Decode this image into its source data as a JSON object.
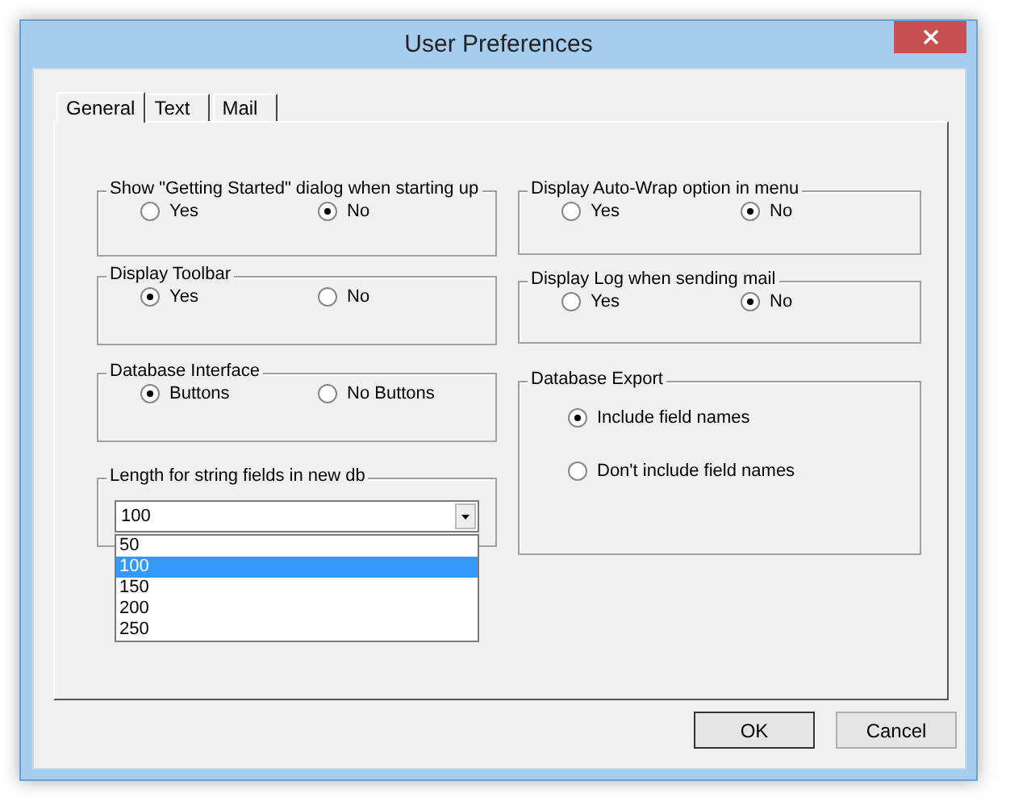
{
  "window": {
    "title": "User Preferences"
  },
  "tabs": [
    {
      "label": "General",
      "selected": true
    },
    {
      "label": "Text",
      "selected": false
    },
    {
      "label": "Mail",
      "selected": false
    }
  ],
  "left_groups": [
    {
      "kind": "radio",
      "title": "Show \"Getting Started\" dialog when starting up",
      "options": [
        {
          "label": "Yes",
          "selected": false
        },
        {
          "label": "No",
          "selected": true
        }
      ]
    },
    {
      "kind": "radio",
      "title": "Display Toolbar",
      "options": [
        {
          "label": "Yes",
          "selected": true
        },
        {
          "label": "No",
          "selected": false
        }
      ]
    },
    {
      "kind": "radio",
      "title": "Database Interface",
      "options": [
        {
          "label": "Buttons",
          "selected": true
        },
        {
          "label": "No Buttons",
          "selected": false
        }
      ]
    },
    {
      "kind": "combo",
      "title": "Length for string fields in new db",
      "value": "100",
      "expanded": true,
      "options": [
        {
          "label": "50",
          "selected": false
        },
        {
          "label": "100",
          "selected": true
        },
        {
          "label": "150",
          "selected": false
        },
        {
          "label": "200",
          "selected": false
        },
        {
          "label": "250",
          "selected": false
        }
      ]
    }
  ],
  "right_groups": [
    {
      "kind": "radio",
      "title": "Display Auto-Wrap option in menu",
      "options": [
        {
          "label": "Yes",
          "selected": false
        },
        {
          "label": "No",
          "selected": true
        }
      ]
    },
    {
      "kind": "radio",
      "title": "Display Log when sending mail",
      "options": [
        {
          "label": "Yes",
          "selected": false
        },
        {
          "label": "No",
          "selected": true
        }
      ]
    },
    {
      "kind": "stack",
      "title": "Database Export",
      "options": [
        {
          "label": "Include field names",
          "selected": true
        },
        {
          "label": "Don't include field names",
          "selected": false
        }
      ]
    }
  ],
  "buttons": [
    "OK",
    "Cancel"
  ]
}
